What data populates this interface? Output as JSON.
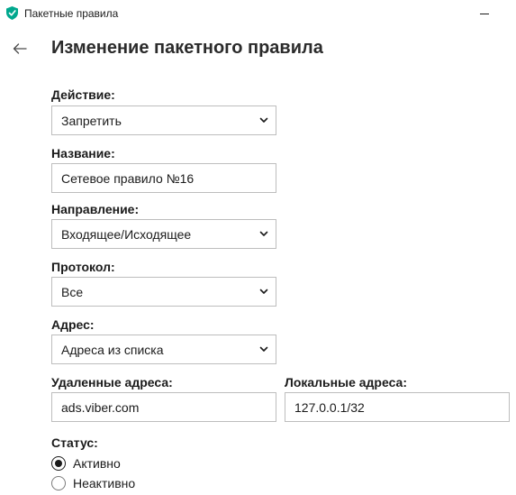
{
  "window": {
    "title": "Пакетные правила",
    "icon": "kaspersky-shield-icon",
    "accent_color": "#00a88e"
  },
  "header": {
    "back_icon": "arrow-left-icon",
    "title": "Изменение пакетного правила"
  },
  "form": {
    "action": {
      "label": "Действие:",
      "value": "Запретить"
    },
    "name": {
      "label": "Название:",
      "value": "Сетевое правило №16"
    },
    "direction": {
      "label": "Направление:",
      "value": "Входящее/Исходящее"
    },
    "protocol": {
      "label": "Протокол:",
      "value": "Все"
    },
    "address": {
      "label": "Адрес:",
      "value": "Адреса из списка"
    },
    "remote_addresses": {
      "label": "Удаленные адреса:",
      "value": "ads.viber.com"
    },
    "local_addresses": {
      "label": "Локальные адреса:",
      "value": "127.0.0.1/32"
    },
    "status": {
      "label": "Статус:",
      "options": [
        {
          "label": "Активно",
          "selected": true
        },
        {
          "label": "Неактивно",
          "selected": false
        }
      ]
    }
  }
}
